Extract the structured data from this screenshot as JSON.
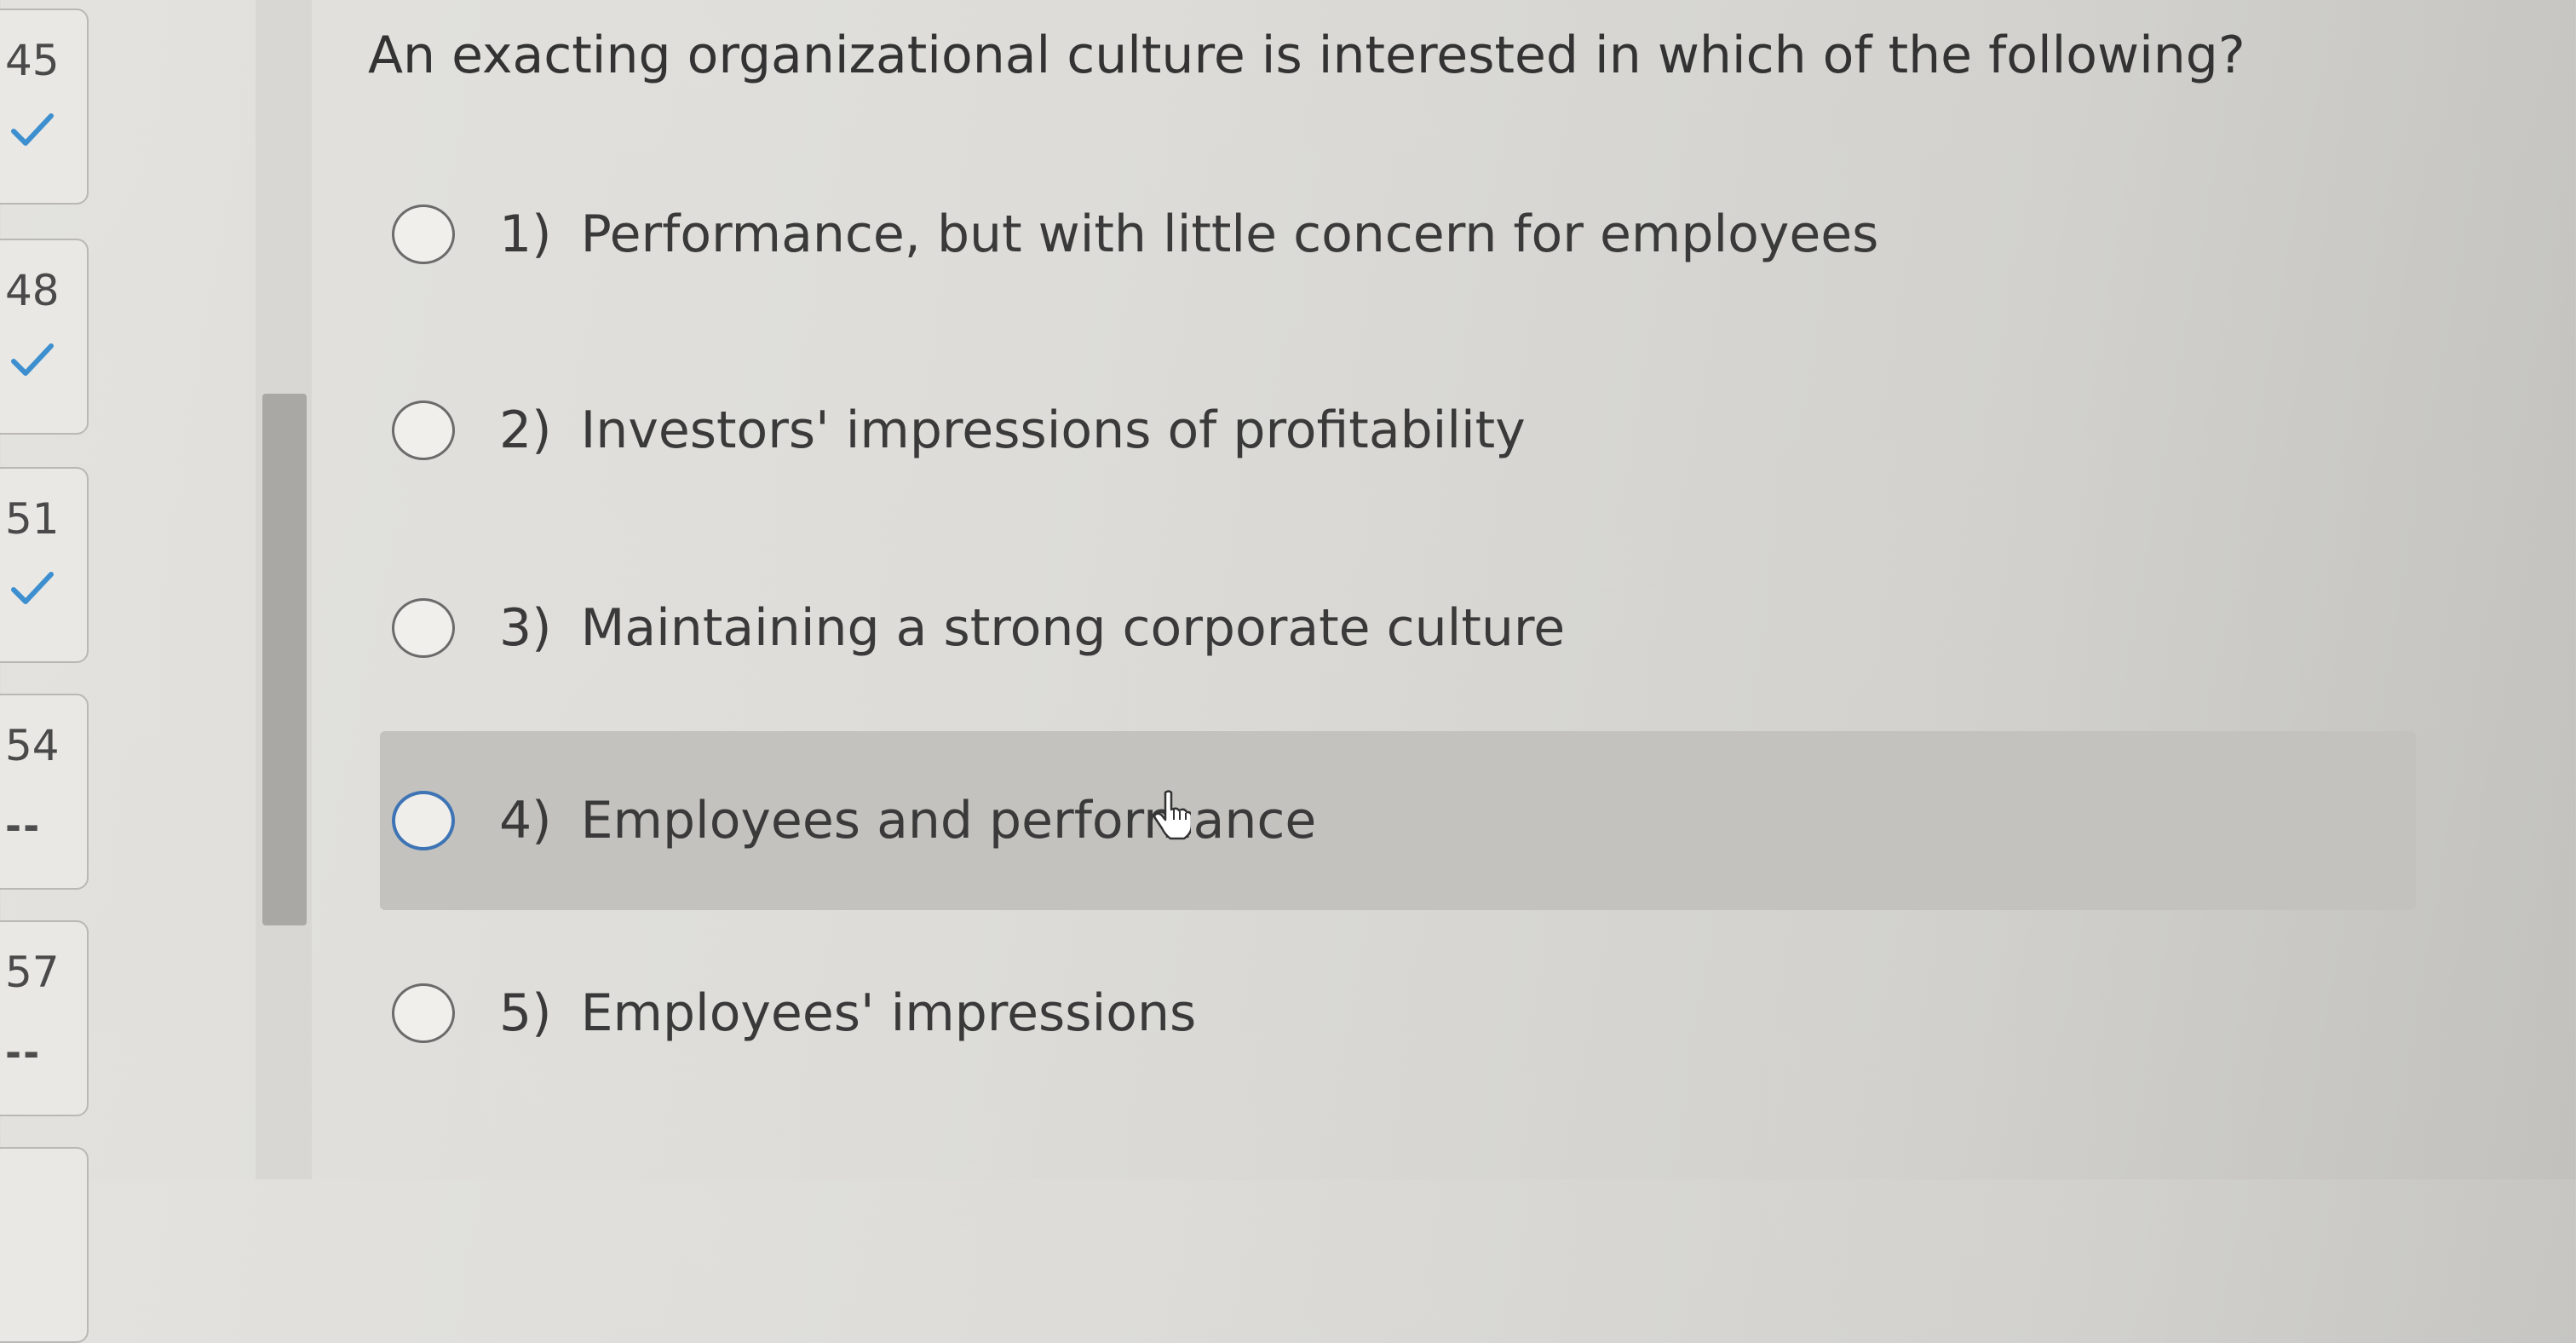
{
  "navigator": {
    "items": [
      {
        "number": "45",
        "status": "answered",
        "icon": "checkmark-icon"
      },
      {
        "number": "48",
        "status": "answered",
        "icon": "checkmark-icon"
      },
      {
        "number": "51",
        "status": "answered",
        "icon": "checkmark-icon"
      },
      {
        "number": "54",
        "status": "unanswered",
        "mark": "--"
      },
      {
        "number": "57",
        "status": "unanswered",
        "mark": "--"
      }
    ]
  },
  "question": {
    "text": "An exacting organizational culture is interested in which of the following?",
    "options": [
      {
        "number": "1)",
        "label": "Performance, but with little concern for employees"
      },
      {
        "number": "2)",
        "label": "Investors' impressions of profitability"
      },
      {
        "number": "3)",
        "label": "Maintaining a strong corporate culture"
      },
      {
        "number": "4)",
        "label": "Employees and performance"
      },
      {
        "number": "5)",
        "label": "Employees' impressions"
      }
    ],
    "hovered_option": "4)"
  },
  "colors": {
    "background": "#dddcd8",
    "hover_row": "#c3c2be",
    "radio_focus": "#3e74b5",
    "checkmark": "#3d8fcf"
  }
}
